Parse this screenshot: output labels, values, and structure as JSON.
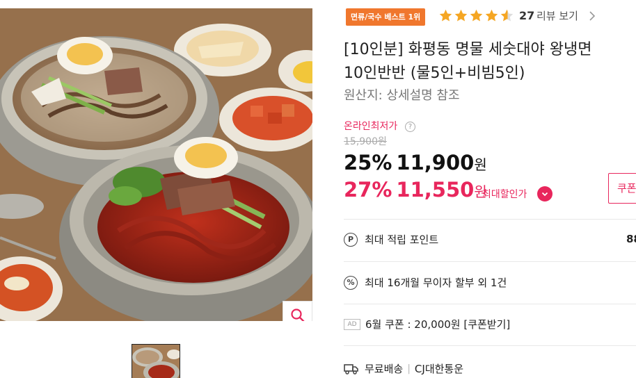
{
  "badge": "면류/국수 베스트 1위",
  "rating": {
    "stars": 4.5,
    "max": 5,
    "count": "27",
    "label": "리뷰 보기"
  },
  "title_line1": "[10인분] 화평동 명물 세숫대야 왕냉면",
  "title_line2": "10인반반 (물5인+비빔5인)",
  "origin": "원산지: 상세설명 참조",
  "price": {
    "lowest_label": "온라인최저가",
    "original": "15,900원",
    "discount_pct": "25%",
    "discount_amount": "11,900",
    "max_discount_pct": "27%",
    "max_discount_amount": "11,550",
    "currency": "원",
    "max_label": "최대할인가"
  },
  "coupon_button": "쿠폰",
  "benefits": {
    "points_label": "최대 적립 포인트",
    "points_value": "88",
    "installment": "최대 16개월 무이자 할부 외 1건",
    "ad_label": "AD",
    "coupon_text": "6월 쿠폰 : 20,000원 [쿠폰받기]",
    "shipping": "무료배송",
    "courier": "CJ대한통운"
  },
  "icons": {
    "point": "P",
    "installment": "%",
    "zoom": "magnifier-icon",
    "chevron": "chevron-right-icon",
    "truck": "truck-icon"
  },
  "colors": {
    "accent": "#e8265c",
    "badge": "#f0772d",
    "star": "#f5a623"
  }
}
